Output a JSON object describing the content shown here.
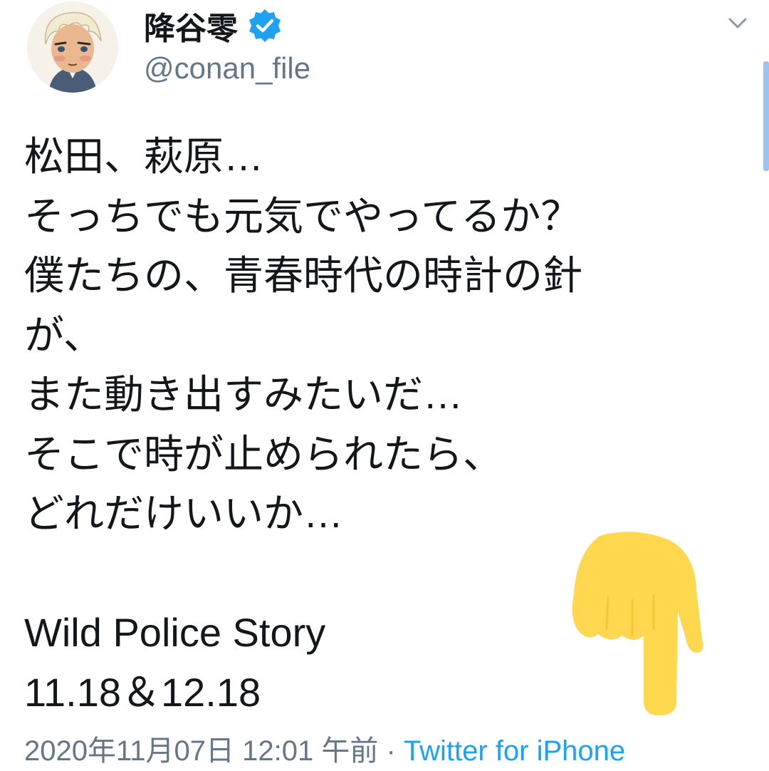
{
  "tweet": {
    "author": {
      "display_name": "降谷零",
      "handle": "@conan_file",
      "verified": true,
      "avatar_icon": "anime-character-avatar"
    },
    "lines": [
      "松田、萩原…",
      "そっちでも元気でやってるか？",
      "僕たちの、青春時代の時計の針",
      "が、",
      "また動き出すみたいだ…",
      "そこで時が止められたら、",
      "どれだけいいか…",
      "",
      "Wild Police Story",
      "11.18＆12.18"
    ],
    "timestamp": "2020年11月07日 12:01 午前",
    "separator": " · ",
    "source": "Twitter for iPhone"
  },
  "icons": {
    "verified": "verified-badge-icon",
    "more": "chevron-down-icon",
    "overlay": "pointing-hand-icon"
  },
  "colors": {
    "text": "#14171a",
    "secondary": "#657786",
    "link": "#1da1f2",
    "hand": "#ffd84f"
  }
}
